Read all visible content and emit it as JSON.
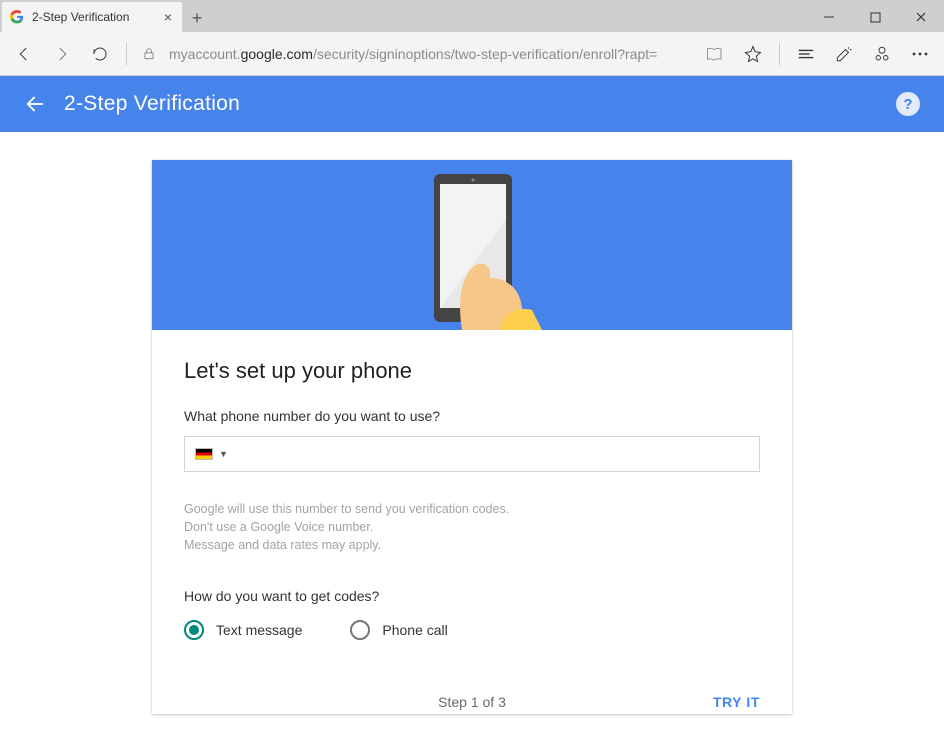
{
  "browser": {
    "tab_title": "2-Step Verification",
    "url_prefix": "myaccount.",
    "url_domain": "google.com",
    "url_path": "/security/signinoptions/two-step-verification/enroll?rapt="
  },
  "header": {
    "title": "2-Step Verification"
  },
  "main": {
    "heading": "Let's set up your phone",
    "question_phone": "What phone number do you want to use?",
    "country_code_label": "Germany",
    "phone_value": "",
    "hint_line1": "Google will use this number to send you verification codes.",
    "hint_line2": "Don't use a Google Voice number.",
    "hint_line3": "Message and data rates may apply.",
    "question_codes": "How do you want to get codes?",
    "radios": {
      "text_message": "Text message",
      "phone_call": "Phone call",
      "selected": "text_message"
    }
  },
  "footer": {
    "step_indicator": "Step 1 of 3",
    "primary_action": "TRY IT"
  }
}
